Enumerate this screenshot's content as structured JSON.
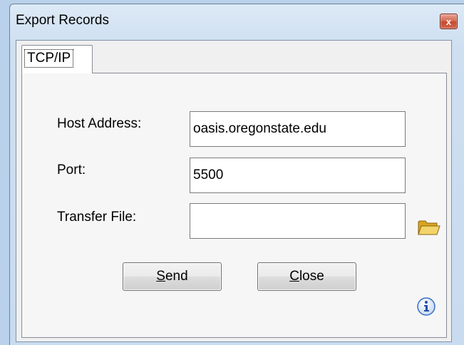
{
  "window": {
    "title": "Export Records",
    "close_glyph": "x"
  },
  "tabs": [
    {
      "label": "TCP/IP",
      "active": true
    }
  ],
  "form": {
    "host_label": "Host Address:",
    "host_value": "oasis.oregonstate.edu",
    "port_label": "Port:",
    "port_value": "5500",
    "file_label": "Transfer File:",
    "file_value": ""
  },
  "buttons": {
    "send_mnemonic": "S",
    "send_rest": "end",
    "close_mnemonic": "C",
    "close_rest": "lose"
  },
  "icons": {
    "browse": "folder-icon",
    "info": "info-icon",
    "close": "close-icon"
  },
  "colors": {
    "window_frame": "#cddff1",
    "close_button": "#c44a2f",
    "folder": "#e8c04a",
    "info": "#2f66c0"
  }
}
